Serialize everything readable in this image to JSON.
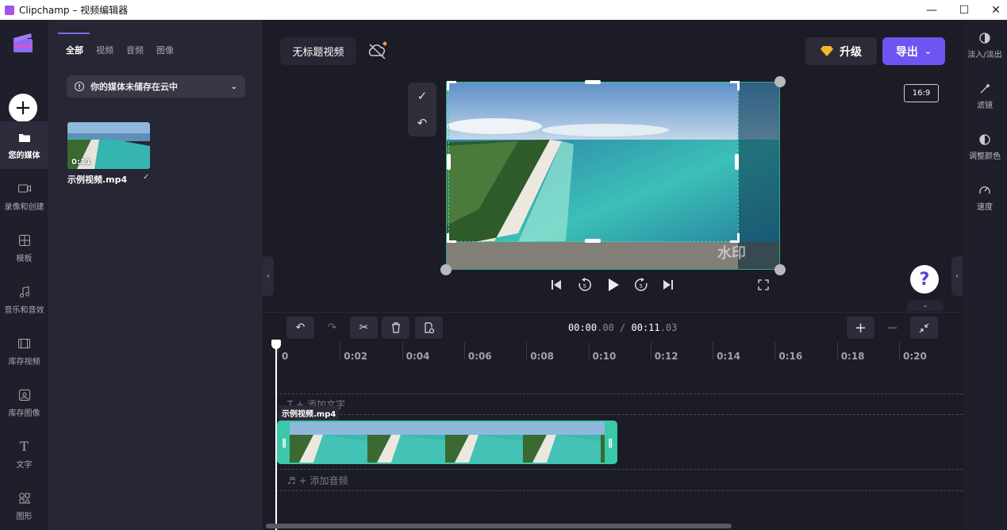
{
  "window": {
    "title": "Clipchamp – 视频编辑器",
    "controls": [
      "—",
      "☐",
      "✕"
    ]
  },
  "nav": {
    "items": [
      {
        "label": "您的媒体",
        "icon": "folder-icon"
      },
      {
        "label": "录像和创建",
        "icon": "camera-icon"
      },
      {
        "label": "模板",
        "icon": "grid-icon"
      },
      {
        "label": "音乐和音效",
        "icon": "music-icon"
      },
      {
        "label": "库存视频",
        "icon": "film-icon"
      },
      {
        "label": "库存图像",
        "icon": "image-icon"
      },
      {
        "label": "文字",
        "icon": "text-icon"
      },
      {
        "label": "图形",
        "icon": "shapes-icon"
      }
    ]
  },
  "media": {
    "tabs": [
      "全部",
      "视频",
      "音频",
      "图像"
    ],
    "cloud_notice": "你的媒体未储存在云中",
    "item": {
      "name": "示例视频.mp4",
      "duration": "0:11",
      "checked": "✓"
    }
  },
  "header": {
    "project_title": "无标题视频",
    "upgrade_label": "升级",
    "export_label": "导出",
    "aspect_ratio": "16:9"
  },
  "preview": {
    "watermark": "水印"
  },
  "right_panel": {
    "items": [
      {
        "label": "淡入/淡出",
        "icon": "fade-icon"
      },
      {
        "label": "滤镜",
        "icon": "wand-icon"
      },
      {
        "label": "调整颜色",
        "icon": "contrast-icon"
      },
      {
        "label": "速度",
        "icon": "speedometer-icon"
      }
    ]
  },
  "timeline": {
    "timecode_current_main": "00:00",
    "timecode_current_frac": ".00",
    "timecode_sep": " / ",
    "timecode_total_main": "00:11",
    "timecode_total_frac": ".03",
    "ruler_ticks": [
      "0",
      "0:02",
      "0:04",
      "0:06",
      "0:08",
      "0:10",
      "0:12",
      "0:14",
      "0:16",
      "0:18",
      "0:20"
    ],
    "text_track_label": "T  + 添加文字",
    "audio_track_label": "♬  + 添加音频",
    "clip_label": "示例视频.mp4"
  },
  "colors": {
    "accent": "#6c55f0",
    "clip_border": "#3ac8a8",
    "background": "#1c1c26"
  }
}
